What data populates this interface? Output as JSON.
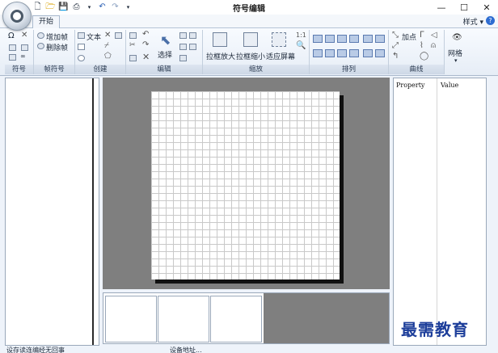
{
  "title": "符号编辑",
  "tabs": {
    "start": "开始"
  },
  "style_menu": "样式",
  "help": "?",
  "ribbon": {
    "groups": {
      "symbol": "符号",
      "frame_symbol": "帧符号",
      "create": "创建",
      "edit": "编辑",
      "zoom": "缩放",
      "arrange": "排列",
      "curve": "曲线"
    },
    "add_frame": "增加帧",
    "delete_frame": "删除帧",
    "text": "文本",
    "select": "选择",
    "zoom_box_in": "拉框放大",
    "zoom_box_out": "拉框缩小",
    "fit_screen": "适应屏幕",
    "add_point": "加点",
    "grid": "网格"
  },
  "properties": {
    "col_property": "Property",
    "col_value": "Value"
  },
  "status": {
    "left": "设存读连编经无回事",
    "right": "设备地址..."
  },
  "watermark": "最需教育"
}
